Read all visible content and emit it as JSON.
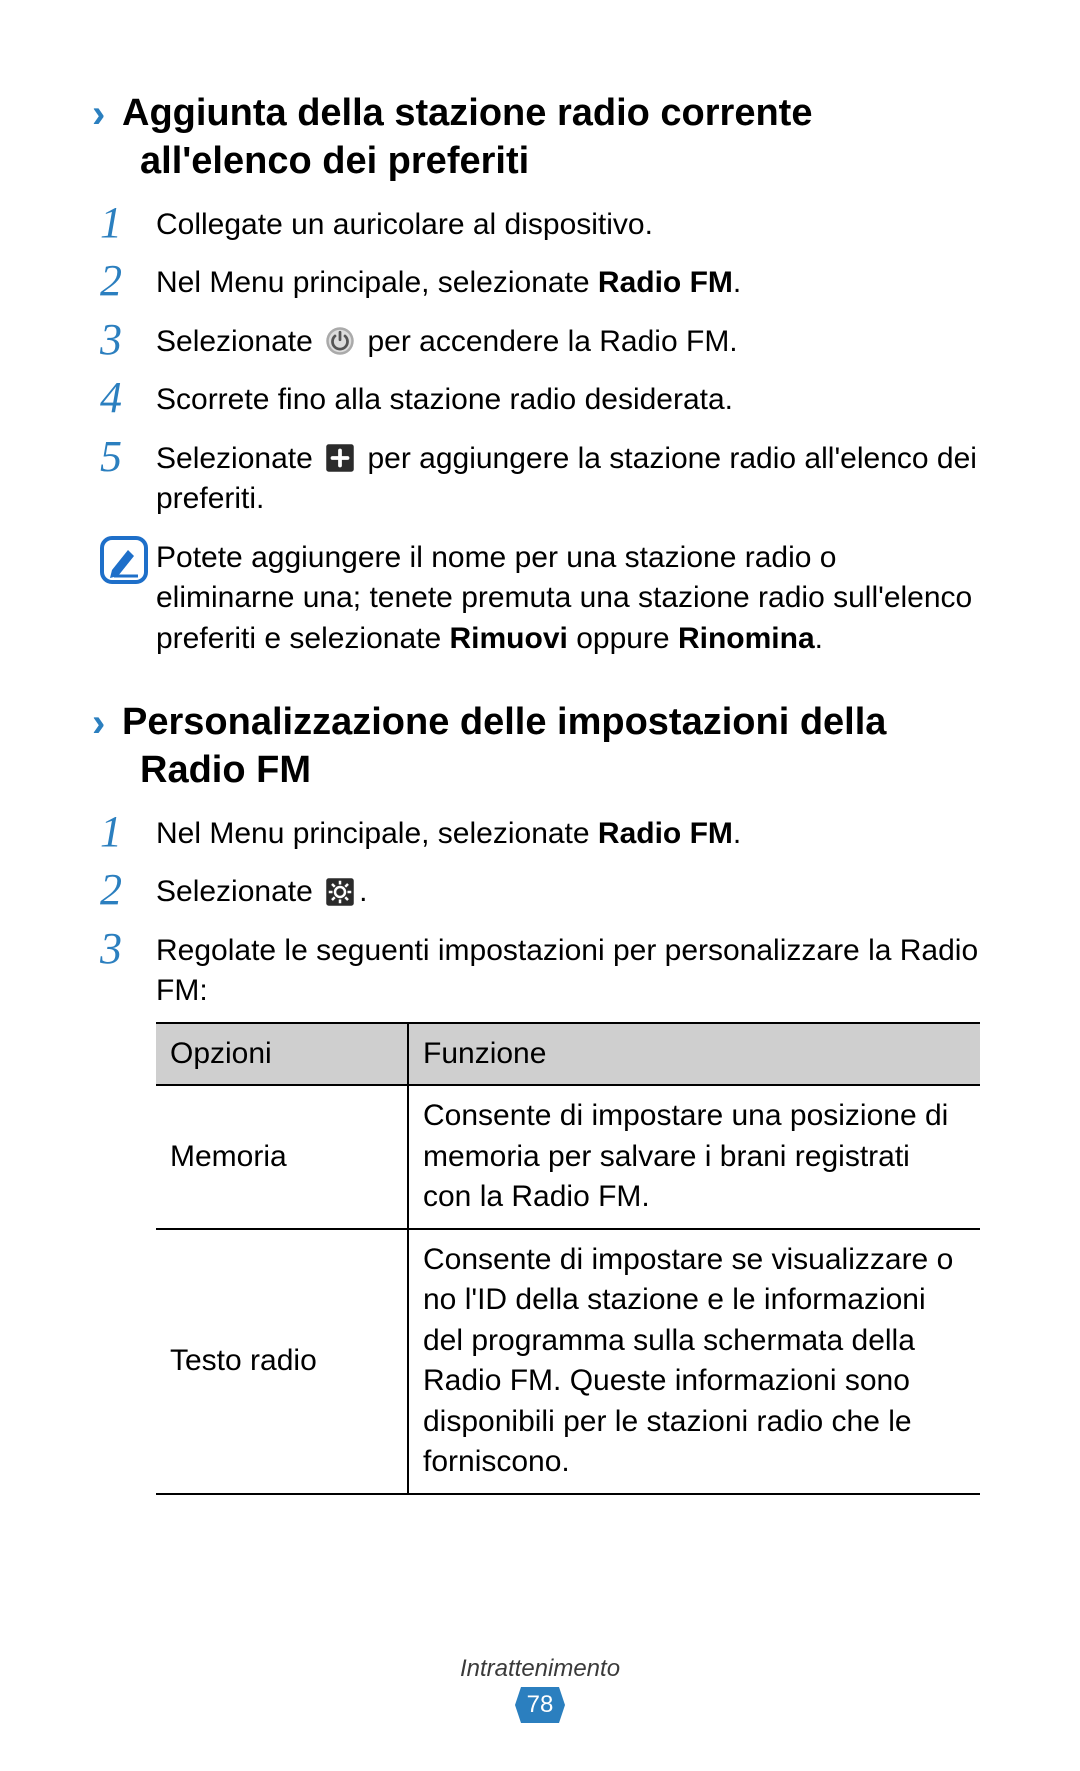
{
  "section1": {
    "heading": "Aggiunta della stazione radio corrente all'elenco dei preferiti",
    "steps": [
      {
        "num": "1",
        "text": "Collegate un auricolare al dispositivo."
      },
      {
        "num": "2",
        "text_pre": "Nel Menu principale, selezionate ",
        "bold": "Radio FM",
        "text_post": "."
      },
      {
        "num": "3",
        "text_pre": "Selezionate ",
        "icon": "power-icon",
        "text_post": " per accendere la Radio FM."
      },
      {
        "num": "4",
        "text": "Scorrete fino alla stazione radio desiderata."
      },
      {
        "num": "5",
        "text_pre": "Selezionate ",
        "icon": "plus-icon",
        "text_post": " per aggiungere la stazione radio all'elenco dei preferiti."
      }
    ],
    "note_pre": "Potete aggiungere il nome per una stazione radio o eliminarne una; tenete premuta una stazione radio sull'elenco preferiti e selezionate ",
    "note_bold1": "Rimuovi",
    "note_mid": " oppure ",
    "note_bold2": "Rinomina",
    "note_post": "."
  },
  "section2": {
    "heading": "Personalizzazione delle impostazioni della Radio FM",
    "steps": [
      {
        "num": "1",
        "text_pre": "Nel Menu principale, selezionate ",
        "bold": "Radio FM",
        "text_post": "."
      },
      {
        "num": "2",
        "text_pre": "Selezionate ",
        "icon": "gear-icon",
        "text_post": "."
      },
      {
        "num": "3",
        "text": "Regolate le seguenti impostazioni per personalizzare la Radio FM:"
      }
    ],
    "table": {
      "header": {
        "col1": "Opzioni",
        "col2": "Funzione"
      },
      "rows": [
        {
          "col1": "Memoria",
          "col2": "Consente di impostare una posizione di memoria per salvare i brani registrati con la Radio FM."
        },
        {
          "col1": "Testo radio",
          "col2": "Consente di impostare se visualizzare o no l'ID della stazione e le informazioni del programma sulla schermata della Radio FM. Queste informazioni sono disponibili per le stazioni radio che le forniscono."
        }
      ]
    }
  },
  "footer": {
    "section": "Intrattenimento",
    "page": "78"
  }
}
